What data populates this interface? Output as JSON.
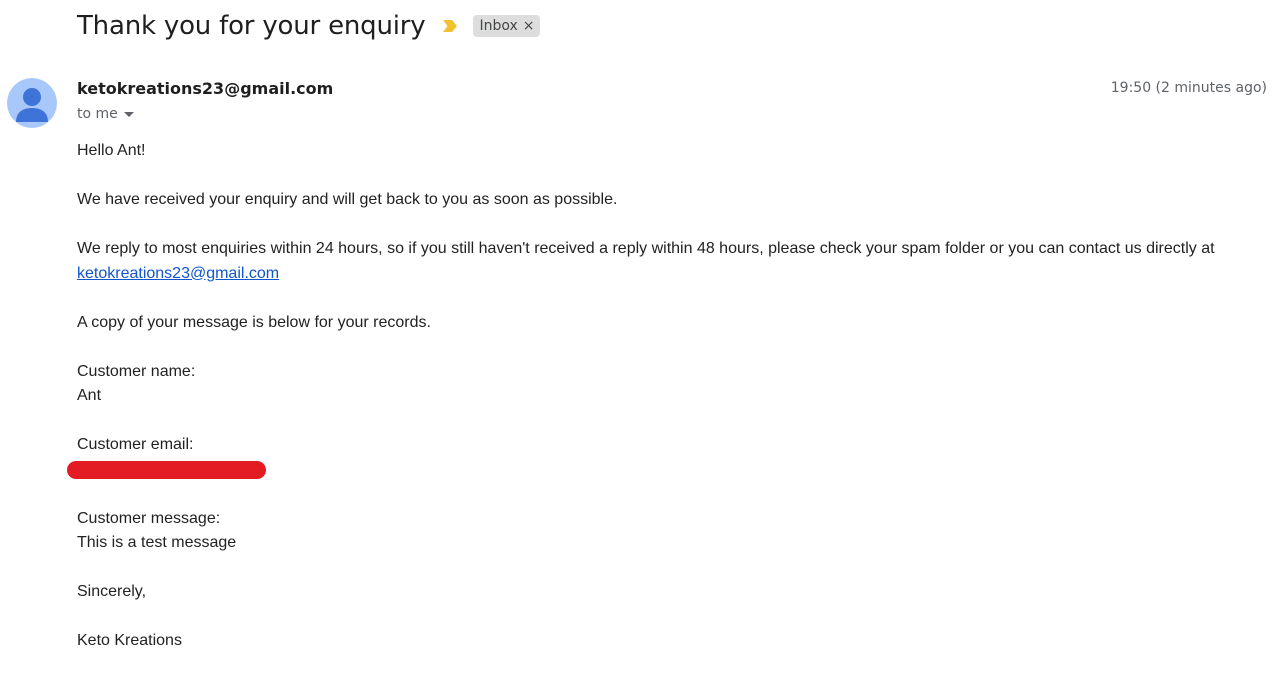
{
  "subject": "Thank you for your enquiry",
  "label": {
    "name": "Inbox",
    "remove_glyph": "×"
  },
  "importance_icon": "importance-marker-icon",
  "sender": {
    "email": "ketokreations23@gmail.com",
    "avatar_icon": "default-avatar-icon",
    "avatar_color": "#a8c7fa",
    "avatar_figure_color": "#3e74d8"
  },
  "timestamp": "19:50 (2 minutes ago)",
  "recipient_label": "to me",
  "body": {
    "greeting": "Hello Ant!",
    "paragraph_1": "We have received your enquiry and will get back to you as soon as possible.",
    "paragraph_2": "We reply to most enquiries within 24 hours, so if you still haven't received a reply within 48 hours, please check your spam folder or you can contact us directly at",
    "contact_link": "ketokreations23@gmail.com",
    "paragraph_3": "A copy of your message is below for your records.",
    "customer_name_label": "Customer name:",
    "customer_name_value": "Ant",
    "customer_email_label": "Customer email:",
    "customer_message_label": "Customer message:",
    "customer_message_value": "This is a test message",
    "signoff": "Sincerely,",
    "signature": "Keto Kreations"
  },
  "colors": {
    "link": "#1155cc",
    "redaction": "#e31b23",
    "importance": "#f2c130",
    "label_chip_bg": "#dddddd"
  }
}
